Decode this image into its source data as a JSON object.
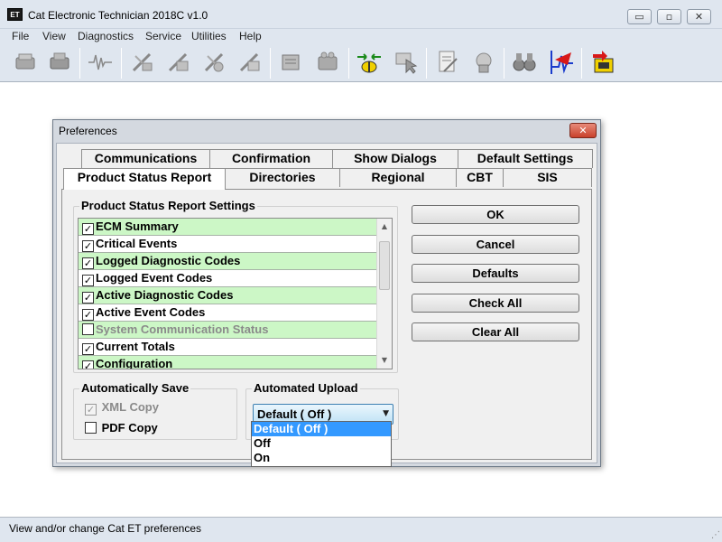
{
  "window": {
    "app_icon_text": "ET",
    "title": "Cat Electronic Technician 2018C v1.0",
    "minimize_glyph": "▭",
    "maximize_glyph": "▫",
    "close_glyph": "✕"
  },
  "menubar": [
    "File",
    "View",
    "Diagnostics",
    "Service",
    "Utilities",
    "Help"
  ],
  "toolbar": {
    "icons": [
      "ecm-summary-icon",
      "status-tool-icon",
      "waveform-icon",
      "active-codes-icon",
      "logged-codes-icon",
      "active-events-icon",
      "logged-events-icon",
      "configuration-icon",
      "calibration-icon",
      "connect-icon",
      "inspect-icon",
      "report-icon",
      "upload-icon",
      "binoculars-icon",
      "flash-program-icon",
      "winflash-icon"
    ]
  },
  "dialog": {
    "title": "Preferences",
    "close_glyph": "✕",
    "tabs_row1": [
      "Communications",
      "Confirmation",
      "Show Dialogs",
      "Default Settings"
    ],
    "tabs_row2": [
      "Product Status Report",
      "Directories",
      "Regional",
      "CBT",
      "SIS"
    ],
    "active_tab": "Product Status Report",
    "settings_group_title": "Product Status Report Settings",
    "settings_items": [
      {
        "label": "ECM Summary",
        "checked": true,
        "enabled": true
      },
      {
        "label": "Critical Events",
        "checked": true,
        "enabled": true
      },
      {
        "label": "Logged Diagnostic Codes",
        "checked": true,
        "enabled": true
      },
      {
        "label": "Logged Event Codes",
        "checked": true,
        "enabled": true
      },
      {
        "label": "Active Diagnostic Codes",
        "checked": true,
        "enabled": true
      },
      {
        "label": "Active Event Codes",
        "checked": true,
        "enabled": true
      },
      {
        "label": "System Communication Status",
        "checked": false,
        "enabled": false
      },
      {
        "label": "Current Totals",
        "checked": true,
        "enabled": true
      },
      {
        "label": "Configuration",
        "checked": true,
        "enabled": true
      }
    ],
    "buttons": {
      "ok": "OK",
      "cancel": "Cancel",
      "defaults": "Defaults",
      "check_all": "Check All",
      "clear_all": "Clear All"
    },
    "auto_save": {
      "title": "Automatically Save",
      "xml_copy": "XML Copy",
      "xml_checked": true,
      "pdf_copy": "PDF Copy",
      "pdf_checked": false
    },
    "auto_upload": {
      "title": "Automated Upload",
      "selected": "Default ( Off )",
      "options": [
        "Default ( Off )",
        "Off",
        "On"
      ]
    }
  },
  "statusbar": {
    "text": "View and/or change Cat ET preferences",
    "grip": "⋰"
  }
}
